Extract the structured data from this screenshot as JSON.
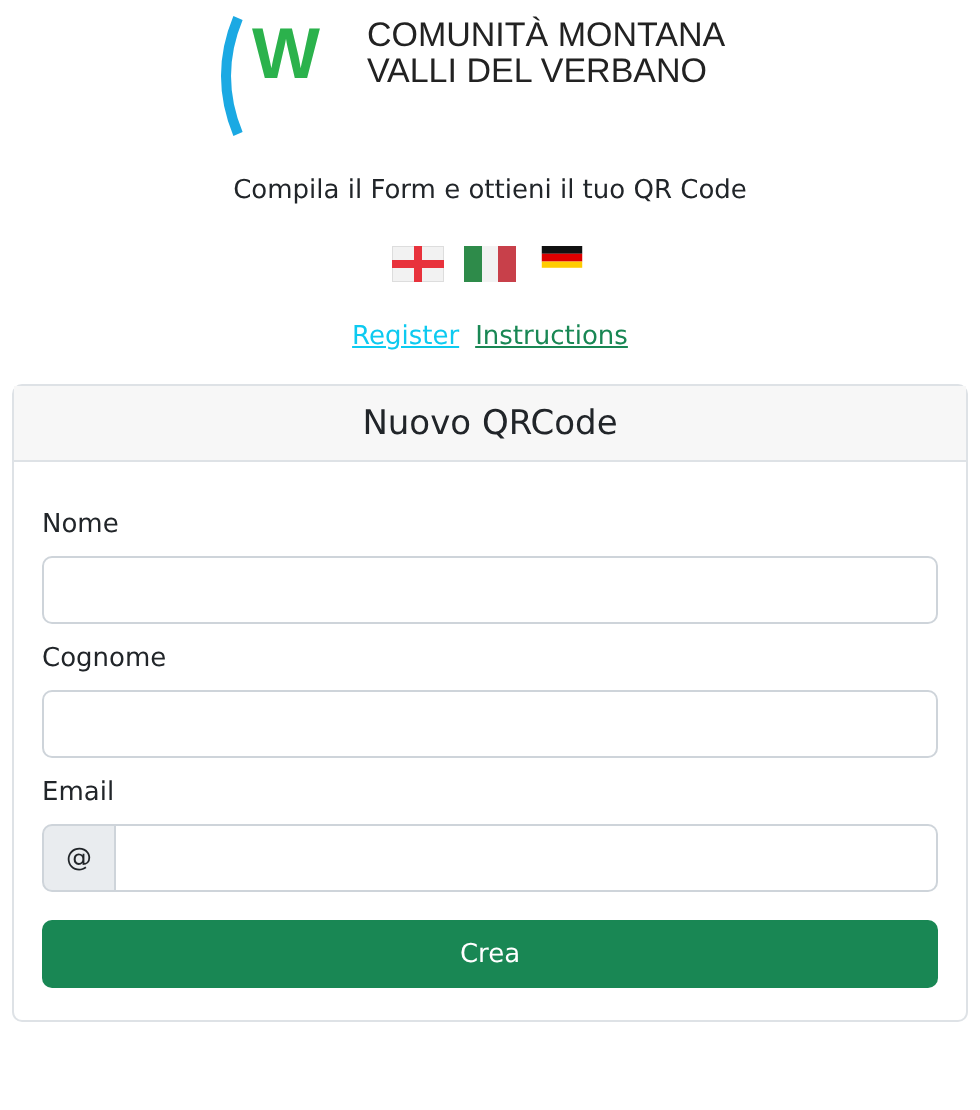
{
  "logo": {
    "mark": "W",
    "line1": "COMUNITÀ MONTANA",
    "line2": "VALLI DEL VERBANO"
  },
  "tagline": "Compila il Form e ottieni il tuo QR Code",
  "flags": [
    {
      "kind": "england"
    },
    {
      "kind": "italy"
    },
    {
      "kind": "germany"
    }
  ],
  "links": [
    {
      "label": "Register",
      "color": "#0dcaf0"
    },
    {
      "label": "Instructions",
      "color": "#198754"
    }
  ],
  "card": {
    "title": "Nuovo QRCode",
    "fields": [
      {
        "label": "Nome"
      },
      {
        "label": "Cognome"
      },
      {
        "label": "Email",
        "prefix": "@"
      }
    ],
    "button": "Crea"
  }
}
